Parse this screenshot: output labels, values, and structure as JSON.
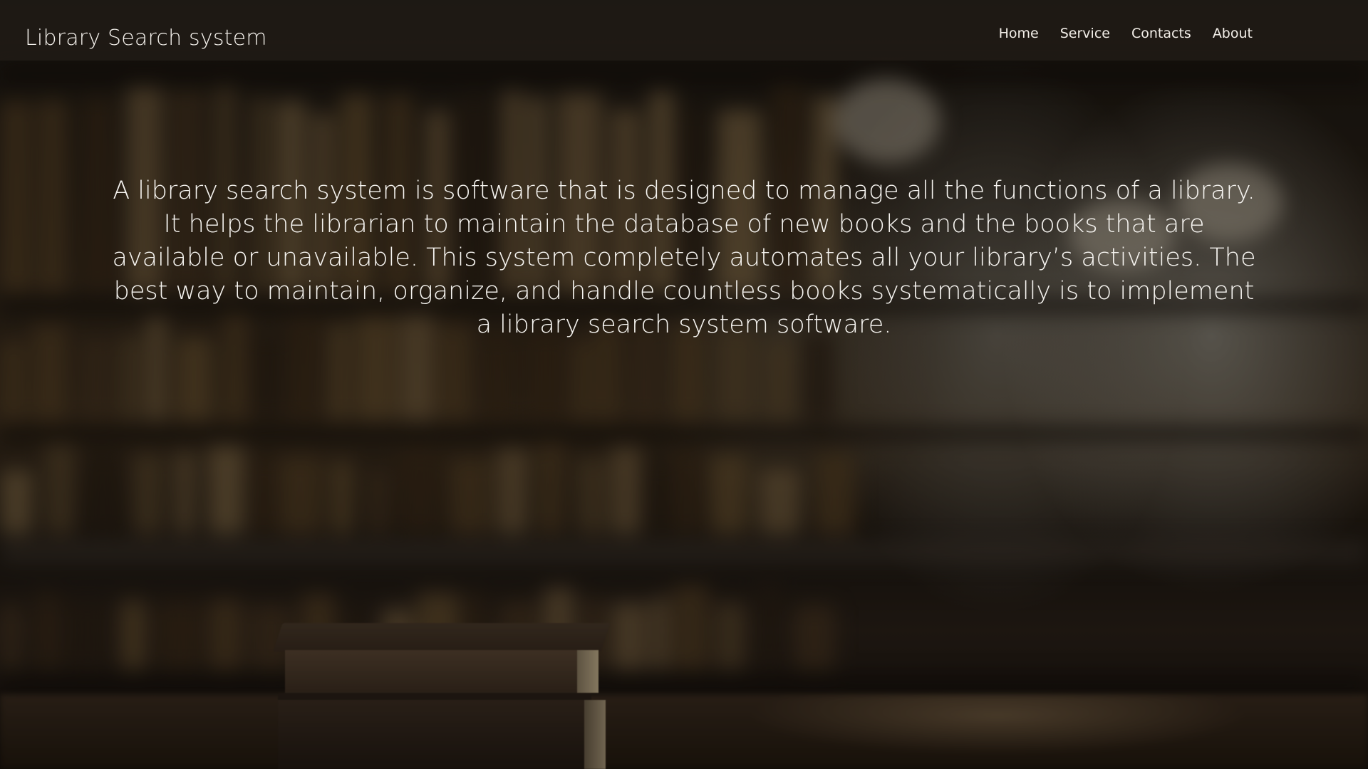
{
  "header": {
    "brand": "Library Search system",
    "nav": [
      {
        "label": "Home"
      },
      {
        "label": "Service"
      },
      {
        "label": "Contacts"
      },
      {
        "label": "About"
      }
    ]
  },
  "hero": {
    "text": "A library search system is software that is designed to manage all the functions of a library. It helps the librarian to maintain the database of new books and the books that are available or unavailable. This system completely automates all your library’s activities. The best way to maintain, organize, and handle countless books systematically is to implement a library search system software."
  },
  "theme": {
    "text_color": "#ffffff",
    "nav_background": "#2d2620"
  }
}
